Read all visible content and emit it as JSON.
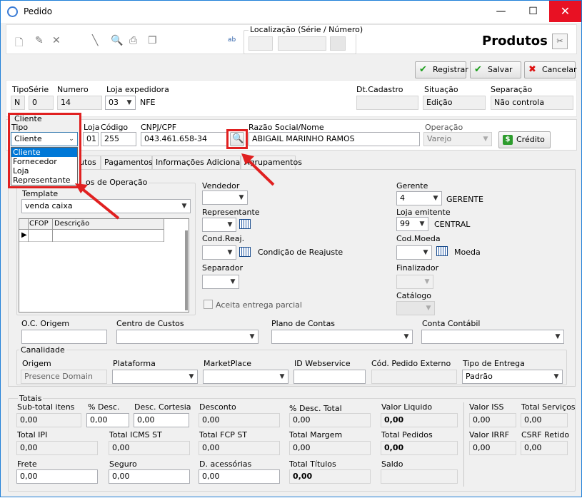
{
  "window": {
    "title": "Pedido",
    "minimize": "—",
    "maximize": "☐",
    "close": "✕"
  },
  "toolbar": {
    "localizacao_label": "Localização (Série / Número)",
    "heading": "Produtos"
  },
  "actions": {
    "registrar": "Registrar",
    "salvar": "Salvar",
    "cancelar": "Cancelar"
  },
  "header": {
    "tipo_label": "Tipo",
    "tipo_value": "N",
    "serie_label": "Série",
    "serie_value": "0",
    "numero_label": "Numero",
    "numero_value": "14",
    "loja_exp_label": "Loja expedidora",
    "loja_exp_value": "03",
    "loja_exp_name": "NFE",
    "dtcad_label": "Dt.Cadastro",
    "dtcad_value": "",
    "situacao_label": "Situação",
    "situacao_value": "Edição",
    "separacao_label": "Separação",
    "separacao_value": "Não controla"
  },
  "cliente": {
    "group_label": "Cliente",
    "tipo_label": "Tipo",
    "tipo_value": "Cliente",
    "tipo_options": [
      "Cliente",
      "Fornecedor",
      "Loja",
      "Representante"
    ],
    "loja_label": "Loja",
    "loja_value": "01",
    "codigo_label": "Código",
    "codigo_value": "255",
    "cnpj_label": "CNPJ/CPF",
    "cnpj_value": "043.461.658-34",
    "razao_label": "Razão Social/Nome",
    "razao_value": "ABIGAIL MARINHO RAMOS",
    "operacao_label": "Operação",
    "operacao_value": "Varejo",
    "credito_label": "Crédito"
  },
  "tabs": [
    "utos",
    "Pagamentos",
    "Informações Adicionais",
    "Agrupamentos"
  ],
  "tipos_operacao": {
    "group_label": "os de Operação",
    "template_label": "Template",
    "template_value": "venda caixa",
    "col_cfop": "CFOP",
    "col_descricao": "Descrição"
  },
  "mid": {
    "vendedor_label": "Vendedor",
    "representante_label": "Representante",
    "condreaj_label": "Cond.Reaj.",
    "condreaj_text": "Condição de Reajuste",
    "separador_label": "Separador",
    "aceita_label": "Aceita entrega parcial"
  },
  "right": {
    "gerente_label": "Gerente",
    "gerente_value": "4",
    "gerente_name": "GERENTE",
    "loja_emit_label": "Loja emitente",
    "loja_emit_value": "99",
    "loja_emit_name": "CENTRAL",
    "codmoeda_label": "Cod.Moeda",
    "codmoeda_text": "Moeda",
    "finalizador_label": "Finalizador",
    "catalogo_label": "Catálogo"
  },
  "row2": {
    "oc_label": "O.C. Origem",
    "centro_label": "Centro de Custos",
    "plano_label": "Plano de Contas",
    "conta_label": "Conta Contábil"
  },
  "canalidade": {
    "group_label": "Canalidade",
    "origem_label": "Origem",
    "origem_value": "Presence Domain",
    "plataforma_label": "Plataforma",
    "marketplace_label": "MarketPlace",
    "idweb_label": "ID Webservice",
    "codext_label": "Cód. Pedido Externo",
    "tipoentrega_label": "Tipo de Entrega",
    "tipoentrega_value": "Padrão"
  },
  "totais": {
    "group_label": "Totais",
    "subtotal_label": "Sub-total itens",
    "subtotal": "0,00",
    "pdesc_label": "% Desc.",
    "pdesc": "0,00",
    "desccort_label": "Desc. Cortesia",
    "desccort": "0,00",
    "desconto_label": "Desconto",
    "desconto": "0,00",
    "pdesctotal_label": "% Desc. Total",
    "pdesctotal": "0,00",
    "valorliq_label": "Valor Liquido",
    "valorliq": "0,00",
    "valoriss_label": "Valor ISS",
    "valoriss": "0,00",
    "totalserv_label": "Total Serviços",
    "totalserv": "0,00",
    "totalipi_label": "Total IPI",
    "totalipi": "0,00",
    "totalicms_label": "Total ICMS ST",
    "totalicms": "0,00",
    "totalfcp_label": "Total FCP ST",
    "totalfcp": "0,00",
    "totalmargem_label": "Total Margem",
    "totalmargem": "0,00",
    "totalpedidos_label": "Total Pedidos",
    "totalpedidos": "0,00",
    "valorirrf_label": "Valor IRRF",
    "valorirrf": "0,00",
    "csrf_label": "CSRF Retido",
    "csrf": "0,00",
    "frete_label": "Frete",
    "frete": "0,00",
    "seguro_label": "Seguro",
    "seguro": "0,00",
    "dacess_label": "D. acessórias",
    "dacess": "0,00",
    "totaltitulos_label": "Total Títulos",
    "totaltitulos": "0,00",
    "saldo_label": "Saldo",
    "saldo": ""
  }
}
